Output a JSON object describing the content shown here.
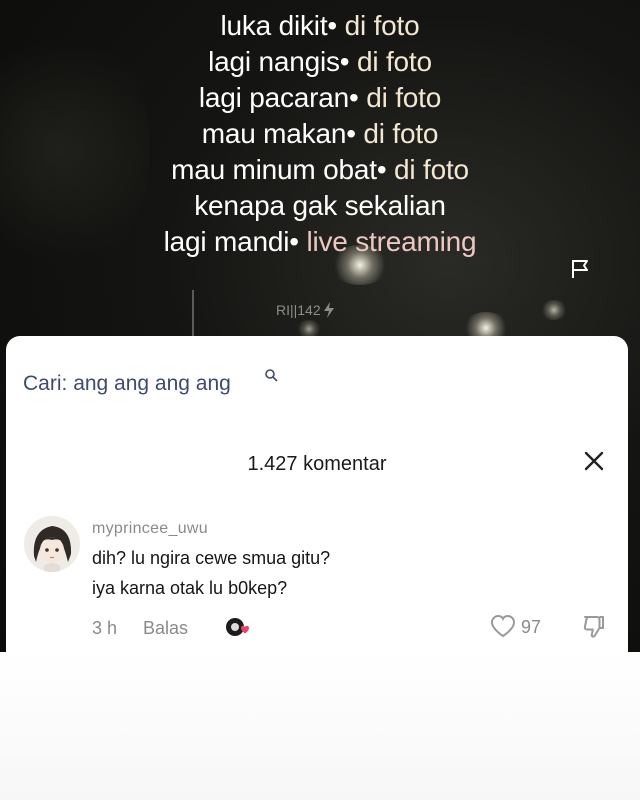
{
  "overlay": {
    "lines": [
      {
        "text": "luka dikit",
        "suffix": "di foto"
      },
      {
        "text": "lagi nangis",
        "suffix": "di foto"
      },
      {
        "text": "lagi pacaran",
        "suffix": "di foto"
      },
      {
        "text": "mau makan",
        "suffix": "di foto"
      },
      {
        "text": "mau minum obat",
        "suffix": "di foto"
      },
      {
        "text": "kenapa gak sekalian",
        "suffix": ""
      },
      {
        "text": "lagi mandi",
        "suffix": "live streaming"
      }
    ],
    "separator": "•",
    "watermark": "RI||142"
  },
  "search": {
    "label": "Cari:",
    "query": "ang ang ang ang"
  },
  "comments_header": {
    "count": "1.427",
    "label": "komentar"
  },
  "comment": {
    "username": "myprincee_uwu",
    "line1": "dih? lu ngira cewe smua gitu?",
    "line2": "iya karna otak lu b0kep?",
    "time": "3 h",
    "reply_label": "Balas",
    "likes": "97"
  },
  "colors": {
    "search_text": "#3d4a73",
    "like_outline": "#999999",
    "badge_pink": "#e8456b"
  }
}
